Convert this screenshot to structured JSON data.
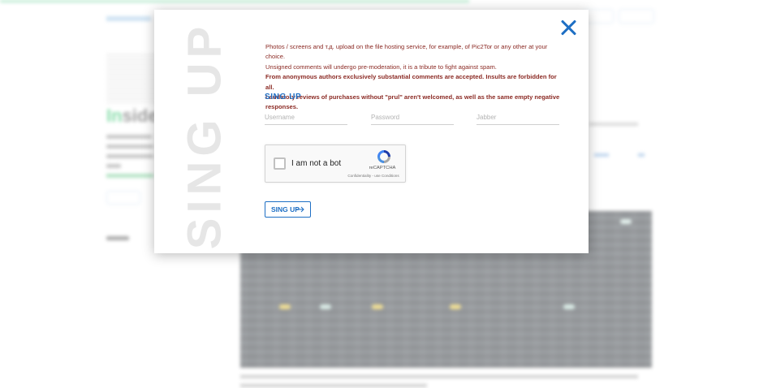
{
  "background": {
    "logo_prefix": "In",
    "logo_suffix": "side"
  },
  "modal": {
    "vertical_title": "SING UP",
    "close_icon": "close-icon",
    "notice": {
      "line1": "Photos / screens and т.д. upload on the file hosting service, for example, of Pic2Tor or any other at your choice.",
      "line2": "Unsigned comments will undergo pre-moderation, it is a tribute to fight against spam.",
      "line3": "From anonymous authors exclusively substantial comments are accepted. Insults are forbidden for all.",
      "line4": "Laudatory reviews of purchases without \"prul\" aren't welcomed, as well as the same empty negative responses."
    },
    "form": {
      "title": "SING UP",
      "username_placeholder": "Username",
      "password_placeholder": "Password",
      "jabber_placeholder": "Jabber",
      "captcha": {
        "label": "I am not a bot",
        "brand": "reCAPTCHA",
        "links": "Confidentiality - use Conditions"
      },
      "submit_label": "SING UP",
      "submit_icon": "arrow-right-icon"
    },
    "accent_color": "#1e6fc4",
    "notice_color": "#8b2a24"
  }
}
